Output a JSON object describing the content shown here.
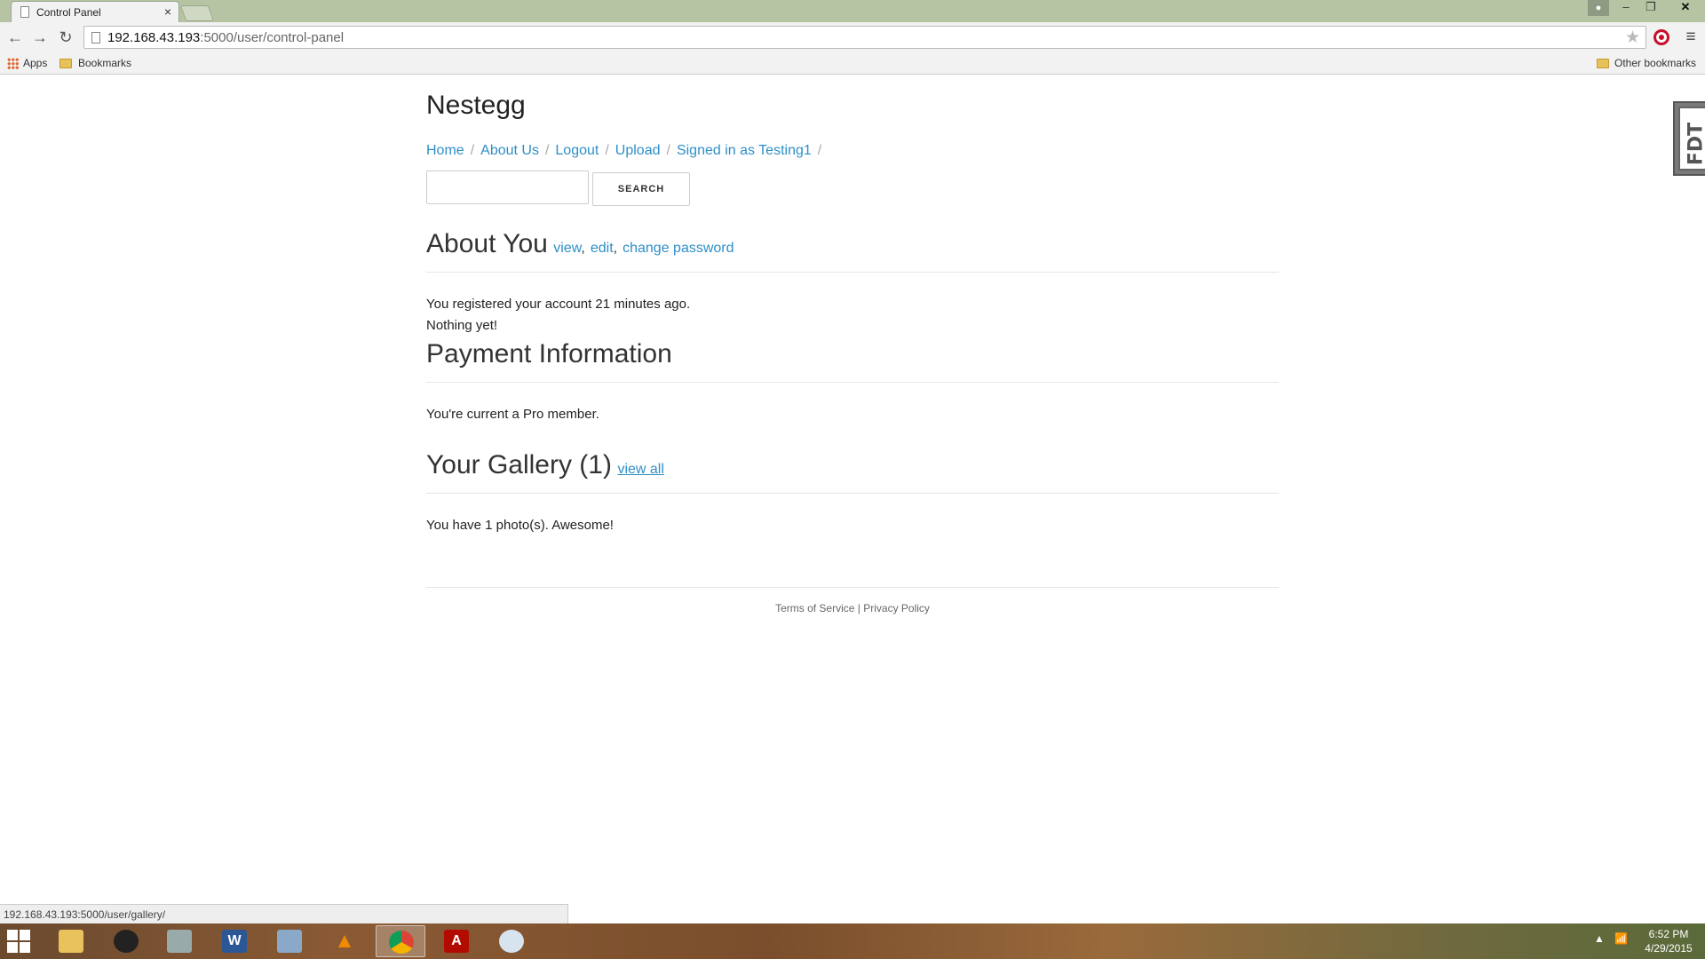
{
  "browser": {
    "tab_title": "Control Panel",
    "tab_close": "×",
    "url_host": "192.168.43.193",
    "url_path": ":5000/user/control-panel",
    "window_user_icon": "person-icon",
    "window_min": "‒",
    "window_max": "❐",
    "window_close": "✕",
    "nav_back": "←",
    "nav_forward": "→",
    "nav_reload": "↻",
    "star": "★",
    "menu": "≡",
    "bookmarks_bar": {
      "apps_label": "Apps",
      "folder_label": "Bookmarks",
      "other_label": "Other bookmarks"
    },
    "status_url": "192.168.43.193:5000/user/gallery/"
  },
  "site": {
    "brand": "Nestegg",
    "nav": [
      {
        "label": "Home"
      },
      {
        "label": "About Us"
      },
      {
        "label": "Logout"
      },
      {
        "label": "Upload"
      },
      {
        "label": "Signed in as Testing1"
      }
    ],
    "nav_separator": "/",
    "search": {
      "value": "",
      "button_label": "SEARCH"
    }
  },
  "about": {
    "title": "About You",
    "links": [
      "view",
      "edit",
      "change password"
    ],
    "comma": ",",
    "registered_text": "You registered your account 21 minutes ago.",
    "status_text": "Nothing yet!"
  },
  "payment": {
    "title": "Payment Information",
    "text": "You're current a Pro member."
  },
  "gallery": {
    "title": "Your Gallery (1)",
    "link": "view all",
    "text": "You have 1 photo(s). Awesome!"
  },
  "footer": {
    "terms": "Terms of Service",
    "separator": "|",
    "privacy": "Privacy Policy"
  },
  "side_tab": {
    "label": "FDT"
  },
  "taskbar": {
    "apps": [
      {
        "icon": "file-explorer-icon"
      },
      {
        "icon": "media-player-icon"
      },
      {
        "icon": "firewall-icon"
      },
      {
        "icon": "word-icon"
      },
      {
        "icon": "calculator-icon"
      },
      {
        "icon": "vlc-icon"
      },
      {
        "icon": "chrome-icon",
        "active": true
      },
      {
        "icon": "acrobat-icon"
      },
      {
        "icon": "paint-icon"
      }
    ],
    "tray_arrow": "▲",
    "tray_signal": "📶",
    "time": "6:52 PM",
    "date": "4/29/2015"
  }
}
